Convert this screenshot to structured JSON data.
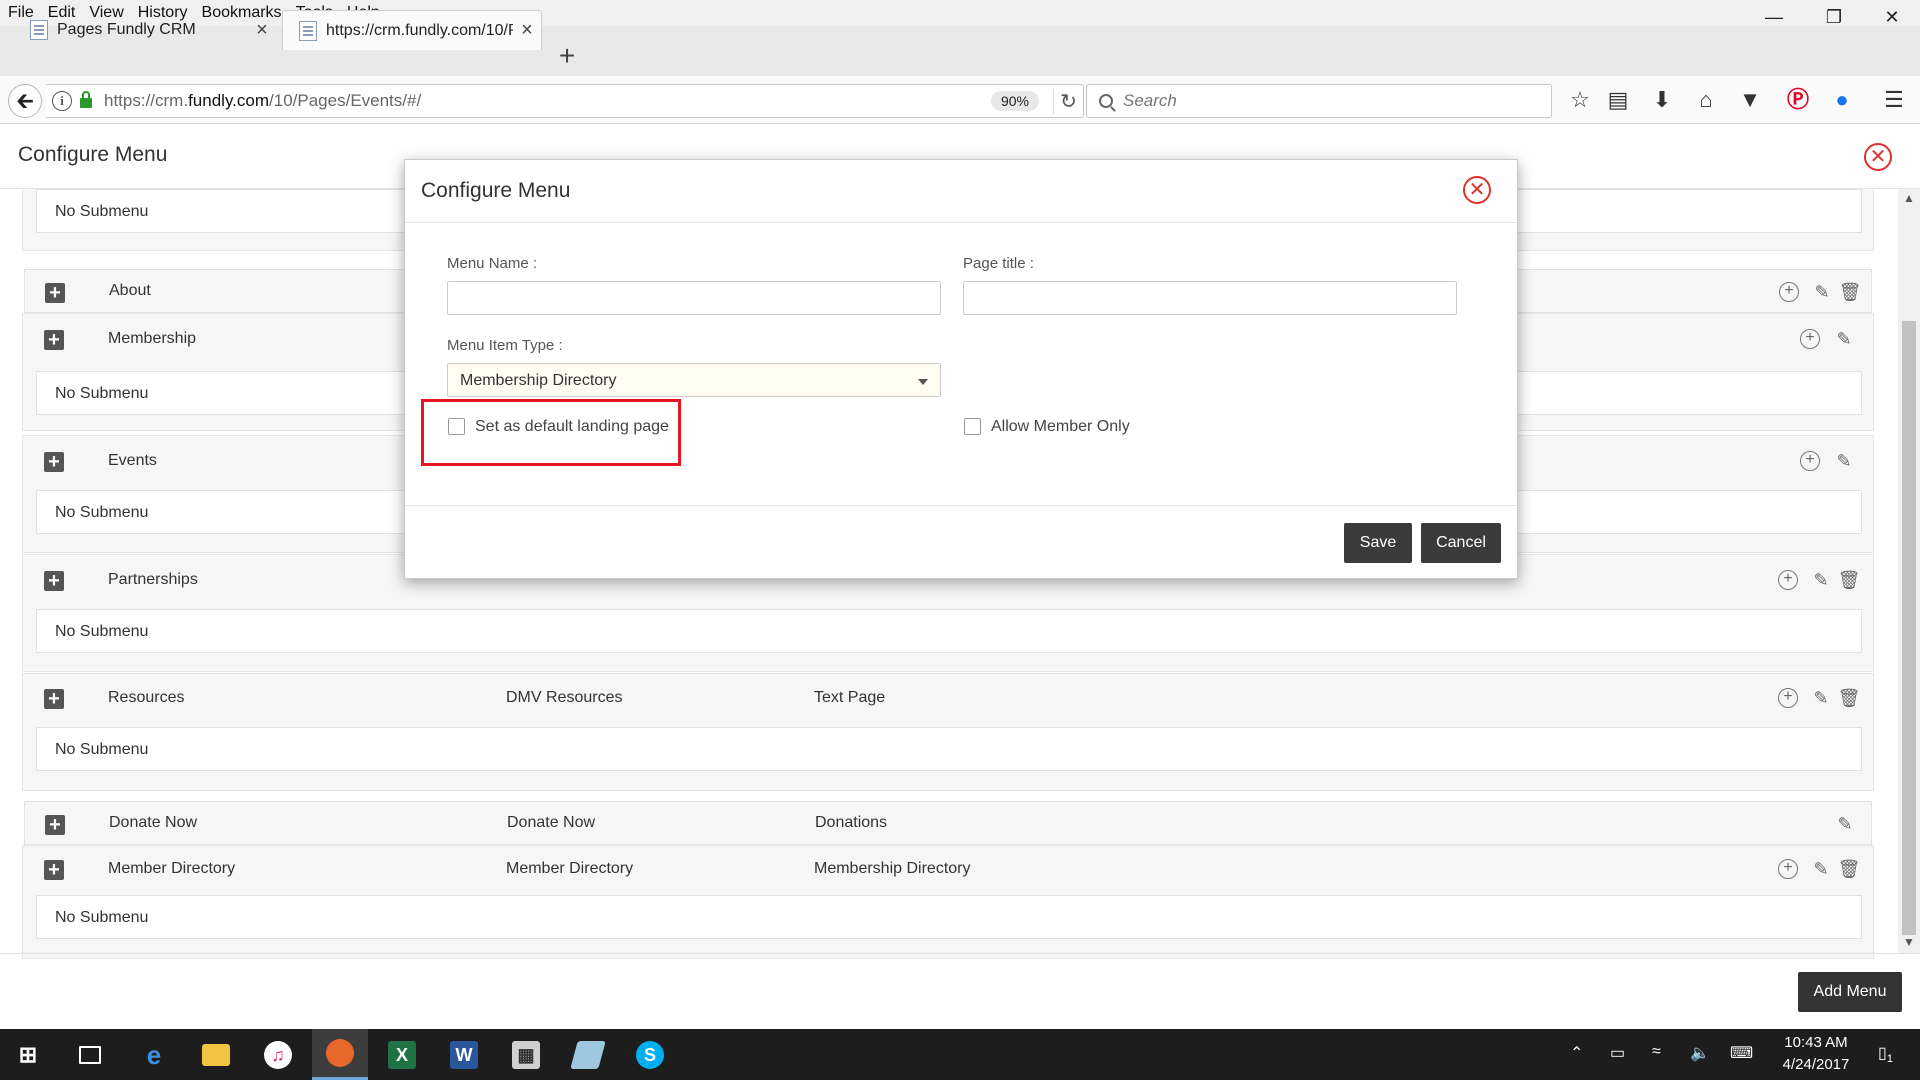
{
  "browser": {
    "menu": [
      "File",
      "Edit",
      "View",
      "History",
      "Bookmarks",
      "Tools",
      "Help"
    ],
    "tabs": [
      {
        "label": "Pages Fundly CRM"
      },
      {
        "label": "https://crm.fundly.com/10/P"
      }
    ],
    "url_prefix": "https://crm.",
    "url_domain": "fundly.com",
    "url_path": "/10/Pages/Events/#/",
    "zoom": "90%",
    "search_placeholder": "Search"
  },
  "page": {
    "title": "Configure Menu",
    "add_menu_label": "Add Menu",
    "no_submenu": "No Submenu",
    "rows": [
      {
        "name": "About",
        "page_title": "",
        "type": ""
      },
      {
        "name": "Membership",
        "page_title": "",
        "type": ""
      },
      {
        "name": "Events",
        "page_title": "",
        "type": ""
      },
      {
        "name": "Partnerships",
        "page_title": "",
        "type": ""
      },
      {
        "name": "Resources",
        "page_title": "DMV Resources",
        "type": "Text Page"
      },
      {
        "name": "Donate Now",
        "page_title": "Donate Now",
        "type": "Donations"
      },
      {
        "name": "Member Directory",
        "page_title": "Member Directory",
        "type": "Membership Directory"
      }
    ]
  },
  "modal": {
    "title": "Configure Menu",
    "menu_name_label": "Menu Name :",
    "menu_name_value": "",
    "page_title_label": "Page title :",
    "page_title_value": "",
    "menu_item_type_label": "Menu Item Type :",
    "menu_item_type_value": "Membership Directory",
    "default_landing_label": "Set as default landing page",
    "default_landing_checked": false,
    "member_only_label": "Allow Member Only",
    "member_only_checked": false,
    "save_label": "Save",
    "cancel_label": "Cancel"
  },
  "taskbar": {
    "time": "10:43 AM",
    "date": "4/24/2017",
    "notification_count": "1"
  },
  "colors": {
    "accent_red": "#e0302d",
    "button_dark": "#3b3b3b",
    "highlight_red": "#e8141f"
  }
}
